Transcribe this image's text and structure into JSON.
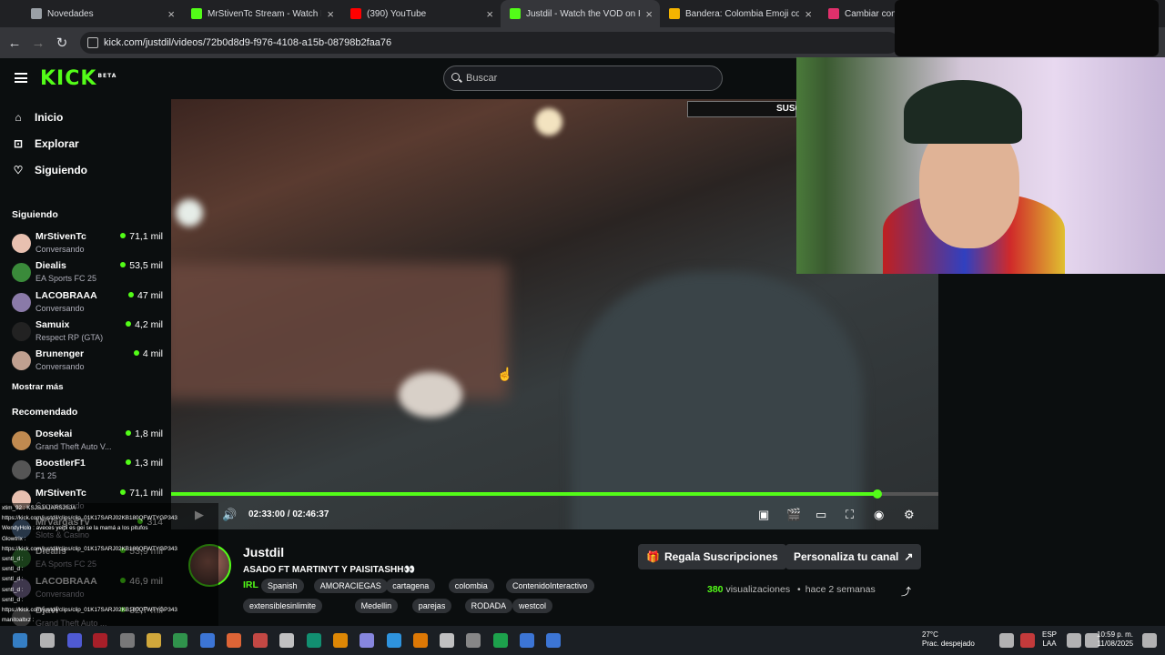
{
  "browser": {
    "tabs": [
      {
        "title": "Novedades",
        "color": "#9aa0a6"
      },
      {
        "title": "MrStivenTc Stream - Watch Live o",
        "color": "#53fc18"
      },
      {
        "title": "(390) YouTube",
        "color": "#ff0000"
      },
      {
        "title": "Justdil - Watch the VOD on Kick",
        "color": "#53fc18"
      },
      {
        "title": "Bandera: Colombia Emoji co",
        "color": "#f4b400"
      },
      {
        "title": "Cambiar contras",
        "color": "#e1306c"
      }
    ],
    "url": "kick.com/justdil/videos/72b0d8d9-f976-4108-a15b-08798b2faa76"
  },
  "header": {
    "logo": "KICK",
    "logo_sup": "BETA",
    "search_placeholder": "Buscar"
  },
  "sidebar": {
    "nav": [
      {
        "label": "Inicio",
        "icon": "home-icon"
      },
      {
        "label": "Explorar",
        "icon": "explore-icon"
      },
      {
        "label": "Siguiendo",
        "icon": "heart-icon"
      }
    ],
    "following_title": "Siguiendo",
    "following": [
      {
        "name": "MrStivenTc",
        "category": "Conversando",
        "viewers": "71,1 mil",
        "color": "#e8c0b0"
      },
      {
        "name": "Diealis",
        "category": "EA Sports FC 25",
        "viewers": "53,5 mil",
        "color": "#3a8a3a"
      },
      {
        "name": "LACOBRAAA",
        "category": "Conversando",
        "viewers": "47 mil",
        "color": "#8a7aa8"
      },
      {
        "name": "Samuix",
        "category": "Respect RP (GTA)",
        "viewers": "4,2 mil",
        "color": "#222"
      },
      {
        "name": "Brunenger",
        "category": "Conversando",
        "viewers": "4 mil",
        "color": "#c0a090"
      }
    ],
    "show_more": "Mostrar más",
    "recommended_title": "Recomendado",
    "recommended": [
      {
        "name": "Dosekai",
        "category": "Grand Theft Auto V...",
        "viewers": "1,8 mil",
        "color": "#c08a50"
      },
      {
        "name": "BoostlerF1",
        "category": "F1 25",
        "viewers": "1,3 mil",
        "color": "#555"
      },
      {
        "name": "MrStivenTc",
        "category": "Conversando",
        "viewers": "71,1 mil",
        "color": "#e8c0b0"
      },
      {
        "name": "MrVargasTv",
        "category": "Slots & Casino",
        "viewers": "314",
        "color": "#5a7aa0"
      },
      {
        "name": "Diealis",
        "category": "EA Sports FC 25",
        "viewers": "53,9 mil",
        "color": "#3a8a3a"
      },
      {
        "name": "LACOBRAAA",
        "category": "Conversando",
        "viewers": "46,9 mil",
        "color": "#8a7aa8"
      },
      {
        "name": "Djavi",
        "category": "Grand Theft Auto ...",
        "viewers": "32,7 mil",
        "color": "#777"
      }
    ]
  },
  "chat_overlay": [
    "xtim_92 : KSJSJAJARSJSJA",
    "https://kick.com/justdil/clips/clip_01K17SARJ02KB180QFWTYGP343",
    "WendyHolo : aveces yeipi es gei se la mamá a los pitufos",
    "Glowtrix :",
    "https://kick.com/justdil/clips/clip_01K17SARJ02KB180QFWTYGP343",
    "sxntl_d :",
    "sxntl_d :",
    "sxntl_d :",
    "sxntl_d :",
    "sxntl_d :",
    "https://kick.com/justdil/clips/clip_01K17SARJ02KB180QFWTYGP343",
    "manitoaltxz :"
  ],
  "player": {
    "sub_badge": "SUSC",
    "time": "02:33:00 / 02:46:37",
    "progress": 0.92
  },
  "info": {
    "channel": "Justdil",
    "stream_title": "ASADO FT MARTINYT Y PAISITASHH👀",
    "category": "IRL",
    "tags_row1": [
      "Spanish",
      "AMORACIEGAS",
      "cartagena",
      "colombia",
      "ContenidoInteractivo"
    ],
    "tags_row2": [
      "extensiblesinlimite",
      "Medellin",
      "parejas",
      "RODADA",
      "westcol"
    ],
    "gift_button": "Regala Suscripciones",
    "customize_button": "Personaliza tu canal",
    "views_count": "380",
    "views_label": "visualizaciones",
    "separator": "•",
    "age": "hace 2 semanas"
  },
  "taskbar": {
    "weather_temp": "27°C",
    "weather_desc": "Prac. despejado",
    "lang": "ESP",
    "lang2": "LAA",
    "time": "10:59 p. m.",
    "date": "11/08/2025"
  }
}
